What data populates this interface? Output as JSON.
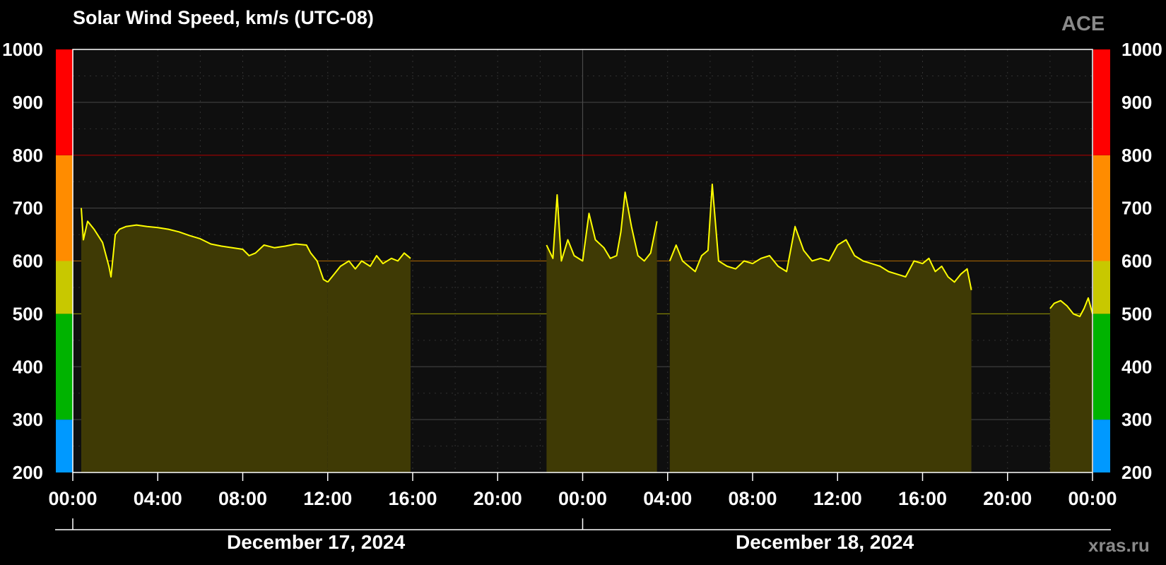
{
  "chart_data": {
    "type": "bar",
    "title": "Solar Wind Speed, km/s (UTC-08)",
    "brand": "ACE",
    "site": "xras.ru",
    "dates": [
      "December 17, 2024",
      "December 18, 2024"
    ],
    "x_tick_labels": [
      "00:00",
      "04:00",
      "08:00",
      "12:00",
      "16:00",
      "20:00",
      "00:00",
      "04:00",
      "08:00",
      "12:00",
      "16:00",
      "20:00",
      "00:00"
    ],
    "x_unit": "hours since 2024-12-17 00:00 (UTC-08)",
    "xlim": [
      0,
      48
    ],
    "ylim": [
      200,
      1000
    ],
    "y_ticks": [
      200,
      300,
      400,
      500,
      600,
      700,
      800,
      900,
      1000
    ],
    "y_tick_labels": [
      "200",
      "300",
      "400",
      "500",
      "600",
      "700",
      "800",
      "900",
      "1000"
    ],
    "grid": true,
    "threshold_lines": [
      {
        "value": 500,
        "color": "#a8a800"
      },
      {
        "value": 600,
        "color": "#c67800"
      },
      {
        "value": 800,
        "color": "#c00000"
      }
    ],
    "color_bands": [
      {
        "from": 200,
        "to": 300,
        "color": "#0099ff"
      },
      {
        "from": 300,
        "to": 500,
        "color": "#00b300"
      },
      {
        "from": 500,
        "to": 600,
        "color": "#c8c800"
      },
      {
        "from": 600,
        "to": 800,
        "color": "#ff8c00"
      },
      {
        "from": 800,
        "to": 1000,
        "color": "#ff0000"
      }
    ],
    "series": [
      {
        "color": "#ffff00",
        "fill_color": "#3f3a05",
        "segments": [
          {
            "x": [
              0.4,
              0.5,
              0.7,
              1.0,
              1.4,
              1.7,
              1.8,
              2.0,
              2.2,
              2.5,
              3.0,
              3.5,
              4.0,
              4.5,
              5.0,
              5.5,
              6.0,
              6.5,
              7.0,
              7.5,
              8.0,
              8.3,
              8.6,
              9.0,
              9.5,
              10.0,
              10.5,
              11.0,
              11.2,
              11.5,
              11.8,
              12.0
            ],
            "y": [
              700,
              640,
              675,
              660,
              635,
              590,
              570,
              650,
              660,
              665,
              668,
              665,
              663,
              660,
              655,
              648,
              642,
              632,
              628,
              625,
              622,
              610,
              615,
              630,
              625,
              628,
              632,
              630,
              615,
              600,
              565,
              560
            ]
          },
          {
            "x": [
              12.0,
              12.3,
              12.6,
              13.0,
              13.3,
              13.6,
              14.0,
              14.3,
              14.6,
              15.0,
              15.3,
              15.6,
              15.9
            ],
            "y": [
              560,
              575,
              590,
              600,
              585,
              600,
              590,
              610,
              595,
              605,
              600,
              615,
              605
            ]
          },
          {
            "x": [
              22.3,
              22.6,
              22.8,
              23.0,
              23.3,
              23.6,
              24.0,
              24.3,
              24.6,
              25.0,
              25.3,
              25.6,
              25.8,
              26.0,
              26.3,
              26.6,
              26.9,
              27.2,
              27.5
            ],
            "y": [
              630,
              605,
              725,
              600,
              640,
              610,
              600,
              690,
              640,
              625,
              605,
              610,
              655,
              730,
              665,
              610,
              600,
              615,
              675
            ]
          },
          {
            "x": [
              28.1,
              28.4,
              28.7,
              29.0,
              29.3,
              29.6,
              29.9,
              30.1,
              30.4,
              30.8,
              31.2,
              31.6,
              32.0,
              32.4,
              32.8,
              33.2,
              33.6,
              34.0,
              34.4,
              34.8,
              35.2,
              35.6,
              36.0,
              36.4,
              36.8,
              37.2,
              37.6,
              38.0,
              38.4,
              38.8,
              39.2,
              39.6,
              40.0,
              40.3,
              40.6,
              40.9,
              41.2,
              41.5,
              41.8,
              42.1,
              42.3
            ],
            "y": [
              600,
              630,
              600,
              590,
              580,
              610,
              620,
              745,
              600,
              590,
              585,
              600,
              595,
              605,
              610,
              590,
              580,
              665,
              620,
              600,
              605,
              600,
              630,
              640,
              610,
              600,
              595,
              590,
              580,
              575,
              570,
              600,
              595,
              605,
              580,
              590,
              570,
              560,
              575,
              585,
              545
            ]
          },
          {
            "x": [
              46.0,
              46.2,
              46.5,
              46.8,
              47.1,
              47.4,
              47.6,
              47.8,
              48.0
            ],
            "y": [
              510,
              520,
              525,
              515,
              500,
              495,
              510,
              530,
              500
            ]
          }
        ]
      }
    ]
  }
}
